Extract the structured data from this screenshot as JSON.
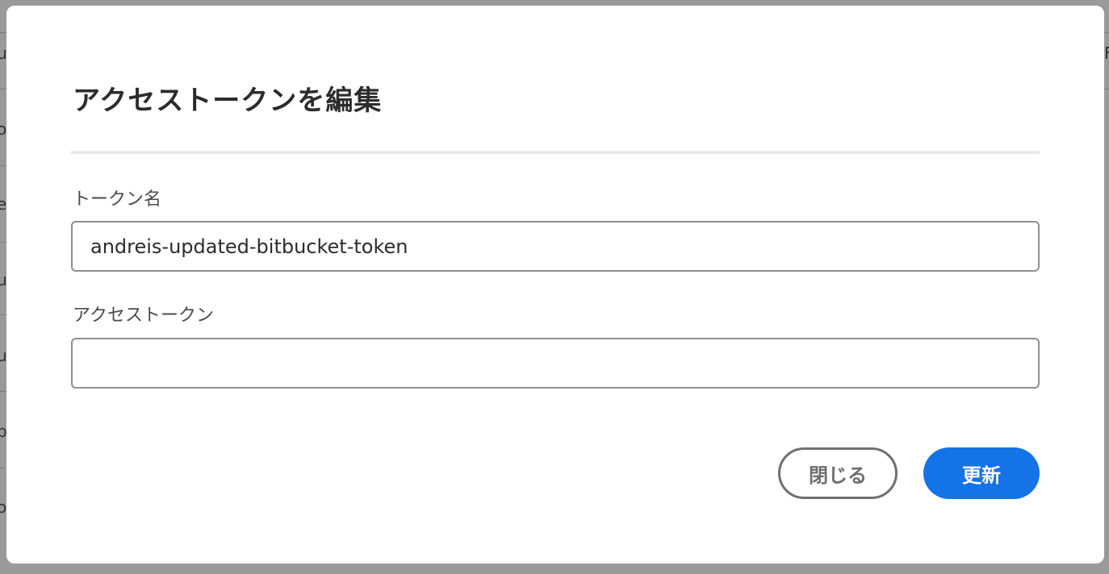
{
  "modal": {
    "title": "アクセストークンを編集",
    "fields": {
      "token_name": {
        "label": "トークン名",
        "value": "andreis-updated-bitbucket-token",
        "placeholder": ""
      },
      "access_token": {
        "label": "アクセストークン",
        "value": "",
        "placeholder": ""
      }
    },
    "buttons": {
      "close_label": "閉じる",
      "update_label": "更新"
    }
  },
  "background": {
    "left_chars": [
      "u",
      "o",
      "e",
      "u",
      "u",
      "b",
      "o"
    ],
    "right_chars": [
      "F"
    ]
  },
  "colors": {
    "overlay": "#9a9a9a",
    "modal_bg": "#ffffff",
    "primary_button": "#1473e6",
    "close_button_border": "#707070",
    "input_border": "#8f8f8f",
    "divider": "#e9e9e9"
  }
}
